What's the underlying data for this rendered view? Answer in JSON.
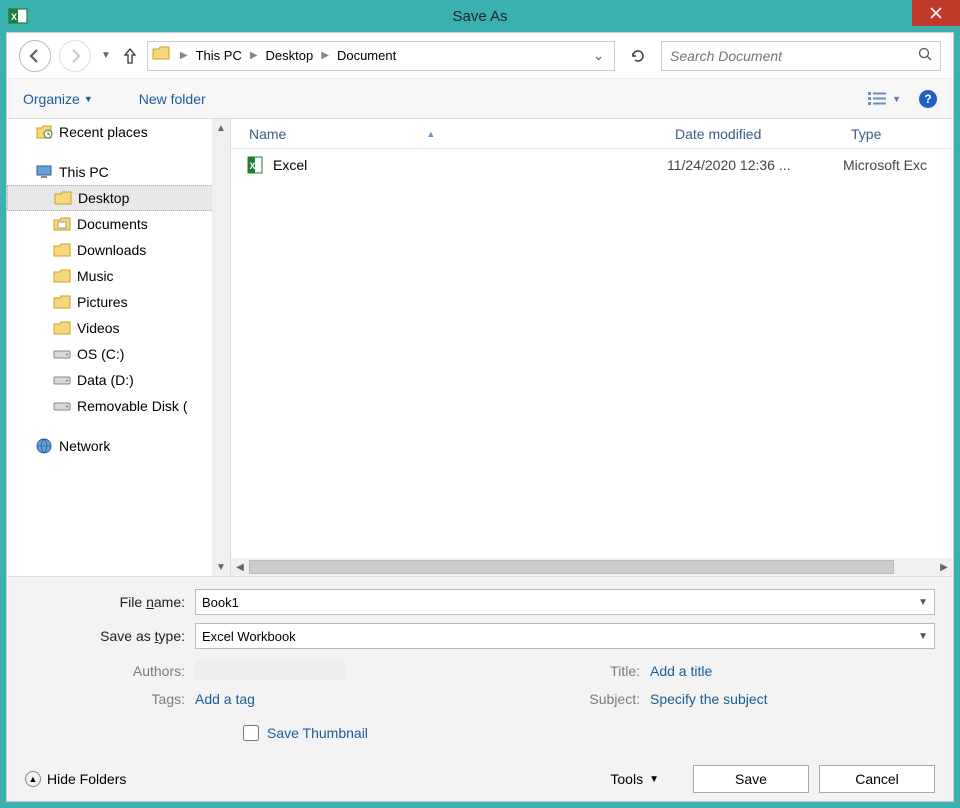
{
  "titlebar": {
    "title": "Save As"
  },
  "nav": {
    "breadcrumb": [
      "This PC",
      "Desktop",
      "Document"
    ],
    "search_placeholder": "Search Document"
  },
  "toolbar": {
    "organize": "Organize",
    "new_folder": "New folder"
  },
  "tree": {
    "items": [
      {
        "label": "Recent places",
        "icon": "recent",
        "level": 0
      },
      {
        "sep": true
      },
      {
        "label": "This PC",
        "icon": "pc",
        "level": 0
      },
      {
        "label": "Desktop",
        "icon": "folder",
        "level": 1,
        "selected": true
      },
      {
        "label": "Documents",
        "icon": "docfolder",
        "level": 1
      },
      {
        "label": "Downloads",
        "icon": "folder",
        "level": 1
      },
      {
        "label": "Music",
        "icon": "folder",
        "level": 1
      },
      {
        "label": "Pictures",
        "icon": "folder",
        "level": 1
      },
      {
        "label": "Videos",
        "icon": "folder",
        "level": 1
      },
      {
        "label": "OS (C:)",
        "icon": "disk",
        "level": 1
      },
      {
        "label": "Data (D:)",
        "icon": "disk",
        "level": 1
      },
      {
        "label": "Removable Disk (",
        "icon": "disk",
        "level": 1
      },
      {
        "sep": true
      },
      {
        "label": "Network",
        "icon": "network",
        "level": 0
      }
    ]
  },
  "filepane": {
    "headers": {
      "name": "Name",
      "date": "Date modified",
      "type": "Type"
    },
    "rows": [
      {
        "name": "Excel",
        "date": "11/24/2020 12:36 ...",
        "type": "Microsoft Exc"
      }
    ]
  },
  "form": {
    "filename_label": "File name:",
    "filename_value": "Book1",
    "savetype_label": "Save as type:",
    "savetype_value": "Excel Workbook",
    "authors_label": "Authors:",
    "tags_label": "Tags:",
    "tags_value": "Add a tag",
    "title_label": "Title:",
    "title_value": "Add a title",
    "subject_label": "Subject:",
    "subject_value": "Specify the subject",
    "save_thumb": "Save Thumbnail"
  },
  "footer": {
    "hide_folders": "Hide Folders",
    "tools": "Tools",
    "save": "Save",
    "cancel": "Cancel"
  }
}
